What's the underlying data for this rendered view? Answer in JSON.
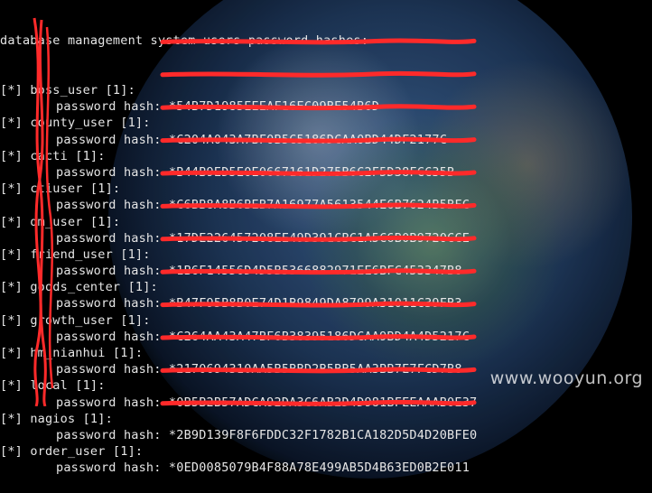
{
  "header": "database management system users password hashes:",
  "marker": "[*]",
  "hash_label": "password hash:",
  "users": [
    {
      "name": "boss_user [1]:",
      "hash": "*54B7D1985EEEAF16EC09BE54B6D"
    },
    {
      "name": "county_user [1]:",
      "hash": "*C204A043A7BF0B5C5186DCAA0BD44DF2177C"
    },
    {
      "name": "cacti [1]:",
      "hash": "*B44B9ED5E0E0667161D275B6C2F5D38FCC35B"
    },
    {
      "name": "ctiuser [1]:",
      "hash": "*C6BB8A8B6BEB7A16977A5613544E6B7624B5BFC"
    },
    {
      "name": "dm_user [1]:",
      "hash": "*17DE226457208EE49D391CBC1A5C6B0B9720CCE"
    },
    {
      "name": "friend_user [1]:",
      "hash": "*1B6F14556D4D5B5366882971EE6BFC453347B8"
    },
    {
      "name": "goods_center [1]:",
      "hash": "*B47F95B8B0E74D1B9849DA8799A31011C39FB3"
    },
    {
      "name": "growth_user [1]:",
      "hash": "*C264AA43A47BF6B38395186DCAA9BD4A4D5217C"
    },
    {
      "name": "hm_nianhui [1]:",
      "hash": "*2170694310AA5B5BBD2B5BB5AA3BB7E7FCD7B8"
    },
    {
      "name": "local [1]:",
      "hash": "*0B5B2B57ADCA92DA3C6AB2D4D981BFEEAAAB0E37"
    },
    {
      "name": "nagios [1]:",
      "hash": "*2B9D139F8F6FDDC32F1782B1CA182D5D4D20BFE0"
    },
    {
      "name": "order_user [1]:",
      "hash": "*0ED0085079B4F88A78E499AB5D4B63ED0B2E011"
    }
  ],
  "watermark": "www.wooyun.org",
  "colors": {
    "text": "#e6e6e6",
    "redaction": "#ff2a2a",
    "background": "#000000"
  }
}
